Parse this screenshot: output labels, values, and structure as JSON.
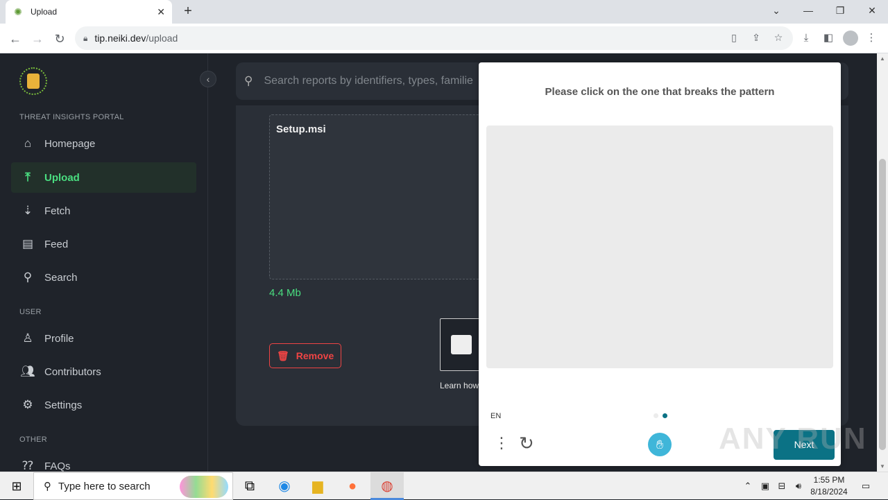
{
  "browser": {
    "tab_title": "Upload",
    "url_host": "tip.neiki.dev",
    "url_path": "/upload"
  },
  "sidebar": {
    "portal_label": "THREAT INSIGHTS PORTAL",
    "user_label": "USER",
    "other_label": "OTHER",
    "items": [
      {
        "label": "Homepage"
      },
      {
        "label": "Upload"
      },
      {
        "label": "Fetch"
      },
      {
        "label": "Feed"
      },
      {
        "label": "Search"
      },
      {
        "label": "Profile"
      },
      {
        "label": "Contributors"
      },
      {
        "label": "Settings"
      },
      {
        "label": "FAQs"
      }
    ]
  },
  "search": {
    "placeholder": "Search reports by identifiers, types, familie"
  },
  "upload": {
    "filename": "Setup.msi",
    "filesize": "4.4 Mb",
    "remove_label": "Remove",
    "learn_text": "Learn how"
  },
  "captcha": {
    "prompt": "Please click on the one that breaks the pattern",
    "language": "EN",
    "next_label": "Next",
    "accent_color": "#0b7285"
  },
  "watermark": "ANY RUN",
  "taskbar": {
    "search_placeholder": "Type here to search",
    "time": "1:55 PM",
    "date": "8/18/2024"
  },
  "colors": {
    "active_nav": "#4ade80",
    "danger": "#ef4444",
    "page_bg": "#1f232a"
  }
}
